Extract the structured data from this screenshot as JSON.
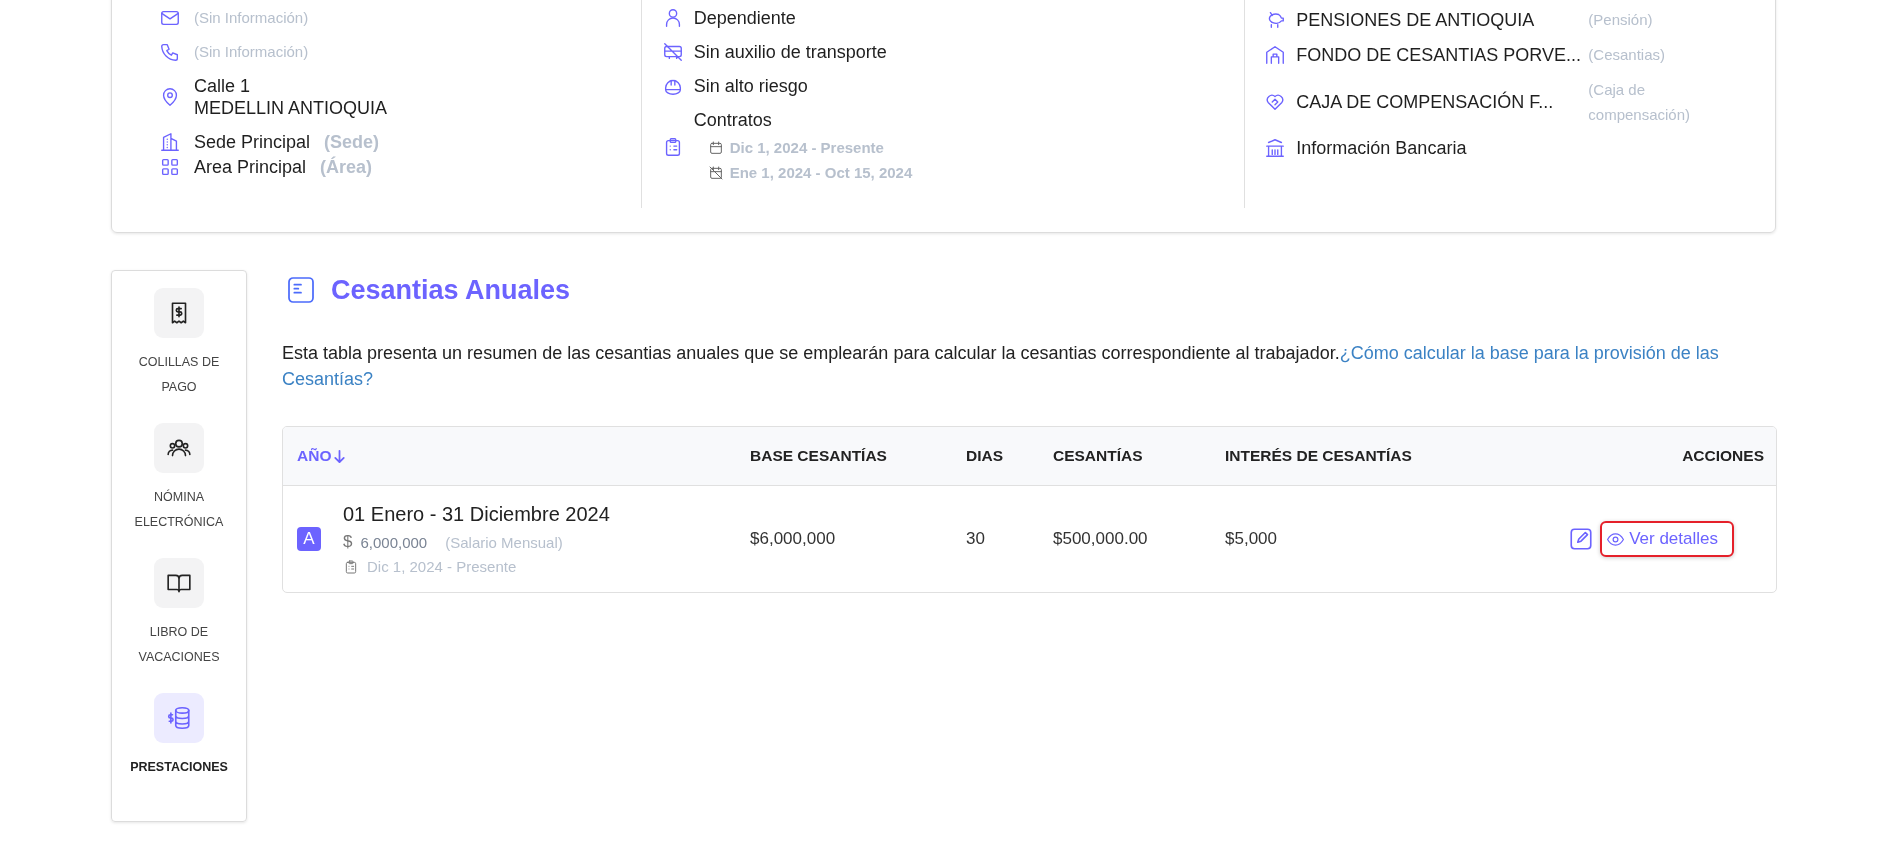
{
  "profile_card": {
    "columns": [
      {
        "items": [
          {
            "kind": "mail",
            "lines": [
              "(Sin Información)"
            ],
            "empty": true
          },
          {
            "kind": "phone",
            "lines": [
              "(Sin Información)"
            ],
            "empty": true
          },
          {
            "kind": "pin",
            "lines": [
              "Calle 1",
              "MEDELLIN ANTIOQUIA"
            ],
            "empty": false
          },
          {
            "kind": "building",
            "lines": [
              "Sede Principal"
            ],
            "note": "(Sede)",
            "empty": false
          },
          {
            "kind": "grid",
            "lines": [
              "Area Principal"
            ],
            "note": "(Área)",
            "empty": false
          }
        ]
      },
      {
        "items": [
          {
            "kind": "person",
            "lines": [
              "Dependiente"
            ],
            "empty": false
          },
          {
            "kind": "bus-off",
            "lines": [
              "Sin auxilio de transporte"
            ],
            "empty": false
          },
          {
            "kind": "helmet",
            "lines": [
              "Sin alto riesgo"
            ],
            "empty": false
          },
          {
            "kind": "clipboard",
            "lines": [
              "Contratos"
            ],
            "empty": false,
            "contracts": [
              {
                "kind": "calendar",
                "text": "Dic 1, 2024 - Presente"
              },
              {
                "kind": "calendar-off",
                "text": "Ene 1, 2024 - Oct 15, 2024"
              }
            ]
          }
        ]
      },
      {
        "items": [
          {
            "kind": "piggy",
            "lines": [
              "PENSIONES DE ANTIOQUIA"
            ],
            "note": "(Pensión)",
            "empty": false
          },
          {
            "kind": "house",
            "lines": [
              "FONDO DE CESANTIAS PORVE..."
            ],
            "note": "(Cesantias)",
            "empty": false
          },
          {
            "kind": "heart",
            "lines": [
              "CAJA DE COMPENSACIÓN F..."
            ],
            "note": "(Caja de compensación)",
            "empty": false
          },
          {
            "kind": "bank",
            "lines": [
              "Información Bancaria"
            ],
            "empty": false
          }
        ]
      }
    ]
  },
  "sidebar": {
    "items": [
      {
        "kind": "receipt",
        "label": "COLILLAS DE PAGO",
        "selected": false
      },
      {
        "kind": "people",
        "label": "NÓMINA ELECTRÓNICA",
        "selected": false
      },
      {
        "kind": "book",
        "label": "LIBRO DE VACACIONES",
        "selected": false
      },
      {
        "kind": "coins",
        "label": "PRESTACIONES",
        "selected": true
      }
    ]
  },
  "section": {
    "title": "Cesantias Anuales",
    "description": "Esta tabla presenta un resumen de las cesantias anuales que se emplearán para calcular la cesantias correspondiente al trabajador.",
    "link_lines": [
      "¿Cómo calcular la base para la provisión de las",
      "Cesantías?"
    ]
  },
  "table": {
    "columns": [
      {
        "label": "AÑO",
        "sorted": true
      },
      {
        "label": "BASE CESANTÍAS",
        "sorted": false
      },
      {
        "label": "DIAS",
        "sorted": false
      },
      {
        "label": "CESANTÍAS",
        "sorted": false
      },
      {
        "label": "INTERÉS DE CESANTÍAS",
        "sorted": false
      },
      {
        "label": "ACCIONES",
        "sorted": false
      }
    ],
    "rows": [
      {
        "avatar": "A",
        "period": "01 Enero - 31 Diciembre 2024",
        "currency": "$",
        "salary": "6,000,000",
        "salary_note": "(Salario Mensual)",
        "contract": "Dic 1, 2024 - Presente",
        "base": "$6,000,000",
        "dias": "30",
        "cesantias": "$500,000.00",
        "interes": "$5,000",
        "details_label": "Ver detalles",
        "details_highlighted": true
      }
    ]
  }
}
